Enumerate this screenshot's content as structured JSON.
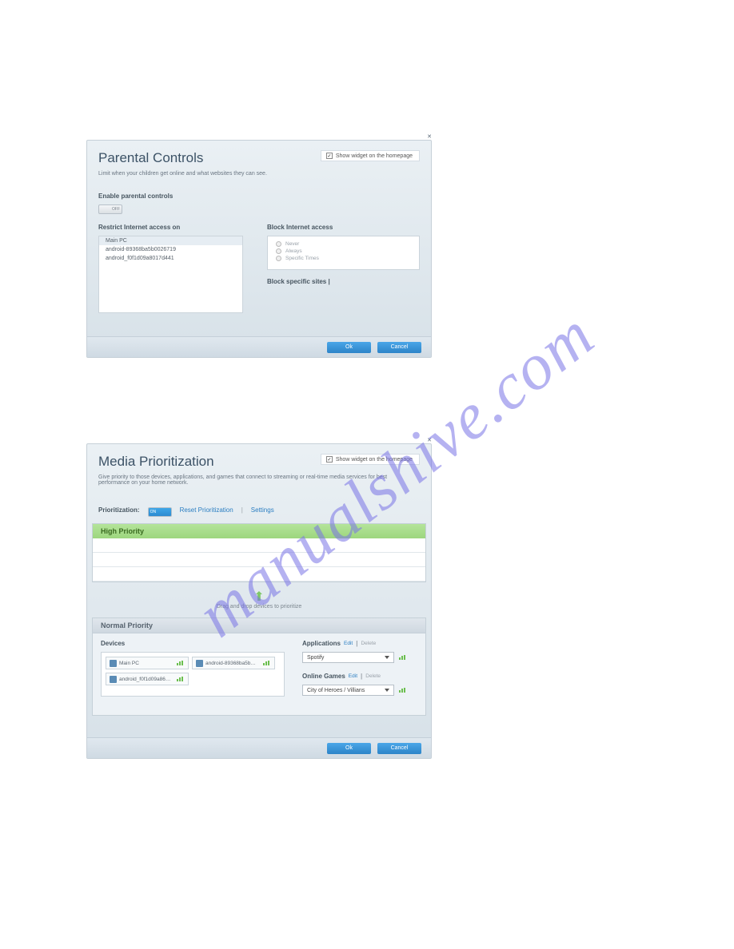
{
  "watermark": "manualshive.com",
  "parental": {
    "title": "Parental Controls",
    "subtitle": "Limit when your children get online and what websites they can see.",
    "show_widget_label": "Show widget on the homepage",
    "show_widget_checked": true,
    "enable_label": "Enable parental controls",
    "toggle_state": "OFF",
    "restrict_title": "Restrict Internet access on",
    "devices": [
      "Main PC",
      "android-89368ba5b0026719",
      "android_f0f1d09a8017d441"
    ],
    "selected_device_index": 0,
    "block_title": "Block Internet access",
    "block_options": [
      "Never",
      "Always",
      "Specific Times"
    ],
    "block_sites": "Block specific sites  |",
    "ok": "Ok",
    "cancel": "Cancel"
  },
  "media": {
    "title": "Media Prioritization",
    "subtitle": "Give priority to those devices, applications, and games that connect to streaming or real-time media services for best performance on your home network.",
    "show_widget_label": "Show widget on the homepage",
    "show_widget_checked": true,
    "prioritization_label": "Prioritization:",
    "toggle_state": "ON",
    "reset_link": "Reset Prioritization",
    "settings_link": "Settings",
    "high_header": "High Priority",
    "drop_text": "Drag and drop devices to prioritize",
    "normal_header": "Normal Priority",
    "devices_label": "Devices",
    "devices": [
      "Main PC",
      "android-89368ba5b…",
      "android_f0f1d09a86…"
    ],
    "applications_label": "Applications",
    "edit": "Edit",
    "delete": "Delete",
    "app_selected": "Spotify",
    "games_label": "Online Games",
    "game_selected": "City of Heroes / Villians",
    "ok": "Ok",
    "cancel": "Cancel"
  }
}
